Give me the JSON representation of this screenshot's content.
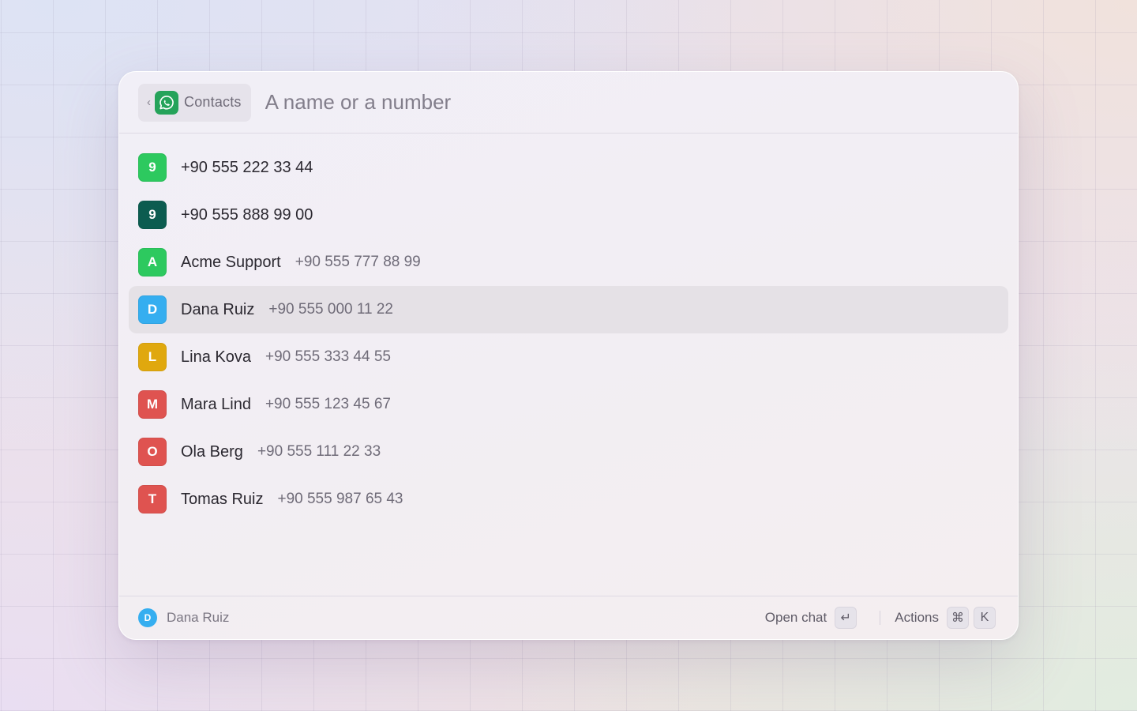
{
  "header": {
    "back_label": "Contacts",
    "search_placeholder": "A name or a number",
    "search_value": ""
  },
  "contacts": [
    {
      "initial": "9",
      "name": "+90 555 222 33 44",
      "phone": "",
      "color": "#2dc95f",
      "selected": false
    },
    {
      "initial": "9",
      "name": "+90 555 888 99 00",
      "phone": "",
      "color": "#0c5c50",
      "selected": false
    },
    {
      "initial": "A",
      "name": "Acme Support",
      "phone": "+90 555 777 88 99",
      "color": "#2dc95f",
      "selected": false
    },
    {
      "initial": "D",
      "name": "Dana Ruiz",
      "phone": "+90 555 000 11 22",
      "color": "#35aef0",
      "selected": true
    },
    {
      "initial": "L",
      "name": "Lina Kova",
      "phone": "+90 555 333 44 55",
      "color": "#e0a80e",
      "selected": false
    },
    {
      "initial": "M",
      "name": "Mara Lind",
      "phone": "+90 555 123 45 67",
      "color": "#df5350",
      "selected": false
    },
    {
      "initial": "O",
      "name": "Ola Berg",
      "phone": "+90 555 111 22 33",
      "color": "#df5350",
      "selected": false
    },
    {
      "initial": "T",
      "name": "Tomas Ruiz",
      "phone": "+90 555 987 65 43",
      "color": "#df5350",
      "selected": false
    }
  ],
  "footer": {
    "selected_initial": "D",
    "selected_name": "Dana Ruiz",
    "selected_color": "#35aef0",
    "primary_action": "Open chat",
    "primary_key": "↵",
    "secondary_action": "Actions",
    "secondary_keys": [
      "⌘",
      "K"
    ]
  },
  "icons": {
    "back": "chevron-left-icon",
    "app": "whatsapp-icon"
  }
}
